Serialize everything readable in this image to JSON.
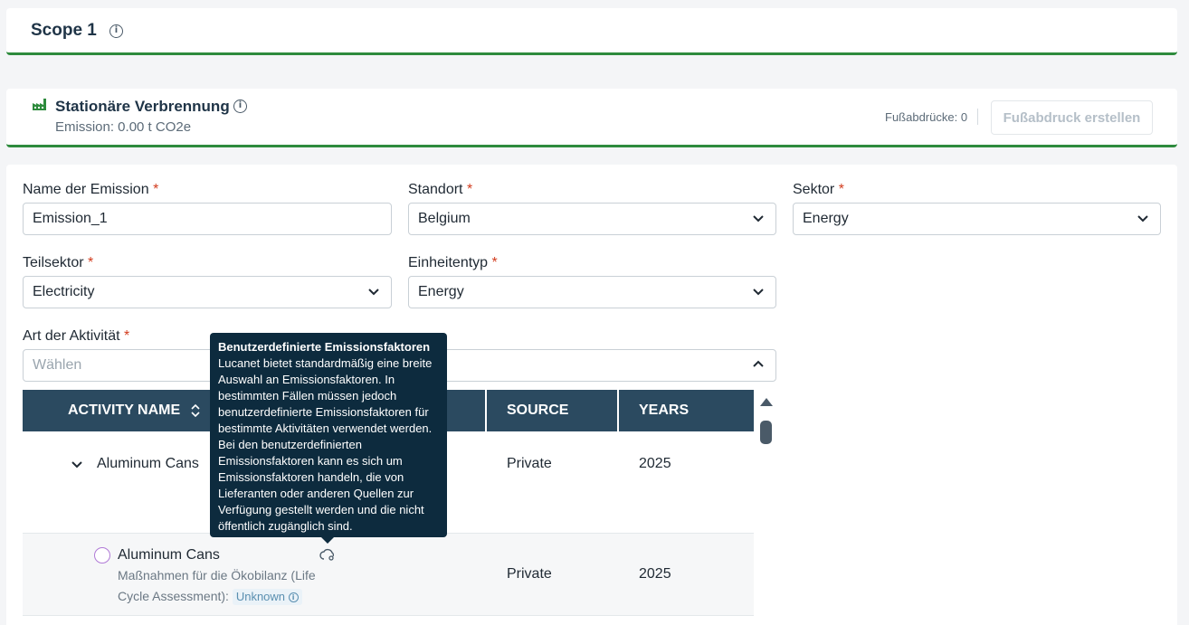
{
  "scope": {
    "title": "Scope 1"
  },
  "section": {
    "title": "Stationäre Verbrennung",
    "emission": "Emission: 0.00 t CO2e",
    "footprints": "Fußabdrücke: 0",
    "create_label": "Fußabdruck erstellen",
    "accent": "#2e8b3d"
  },
  "form": {
    "name": {
      "label": "Name der Emission",
      "value": "Emission_1"
    },
    "location": {
      "label": "Standort",
      "value": "Belgium"
    },
    "sector": {
      "label": "Sektor",
      "value": "Energy"
    },
    "subsector": {
      "label": "Teilsektor",
      "value": "Electricity"
    },
    "unit_type": {
      "label": "Einheitentyp",
      "value": "Energy"
    },
    "activity": {
      "label": "Art der Aktivität",
      "placeholder": "Wählen"
    },
    "required_mark": "*"
  },
  "table": {
    "columns": [
      "ACTIVITY NAME",
      "SOURCE",
      "YEARS"
    ],
    "header_color": "#2b4a60",
    "rows": [
      {
        "name": "Aluminum Cans",
        "source": "Private",
        "years": "2025"
      },
      {
        "name": "Aluminum Cans",
        "sub1": "Maßnahmen für die Ökobilanz (Life",
        "sub2": "Cycle Assessment):",
        "badge": "Unknown",
        "source": "Private",
        "years": "2025"
      }
    ]
  },
  "tooltip": {
    "title": "Benutzerdefinierte Emissionsfaktoren",
    "body": "Lucanet bietet standardmäßig eine breite Auswahl an Emissionsfaktoren. In bestimmten Fällen müssen jedoch benutzerdefinierte Emissionsfaktoren für bestimmte Aktivitäten verwendet werden. Bei den benutzerdefinierten Emissionsfaktoren kann es sich um Emissionsfaktoren handeln, die von Lieferanten oder anderen Quellen zur Verfügung gestellt werden und die nicht öffentlich zugänglich sind."
  }
}
